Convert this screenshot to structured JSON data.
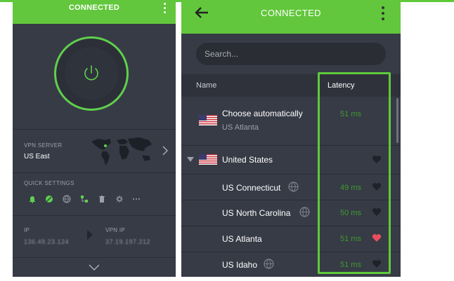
{
  "colors": {
    "accent": "#62c73c",
    "panel": "#373b46",
    "latency": "#3e9a2c",
    "favorite": "#e84e5d"
  },
  "left_panel": {
    "status": "CONNECTED",
    "vpn_server_label": "VPN SERVER",
    "vpn_server_value": "US East",
    "quick_settings_label": "QUICK SETTINGS",
    "quick_settings_icons": [
      "bell-icon",
      "block-icon",
      "globe-shield-icon",
      "network-icon",
      "trash-icon",
      "gear-icon",
      "more-icon"
    ],
    "ip_label": "IP",
    "ip_value": "136.49.23.124",
    "vpn_ip_label": "VPN IP",
    "vpn_ip_value": "37.19.197.212"
  },
  "right_panel": {
    "status": "CONNECTED",
    "search_placeholder": "Search...",
    "col_name": "Name",
    "col_latency": "Latency",
    "auto": {
      "name": "Choose automatically",
      "sub": "US Atlanta",
      "latency": "51 ms"
    },
    "country": {
      "name": "United States"
    },
    "servers": [
      {
        "name": "US Connecticut",
        "latency": "49 ms",
        "favorite": false
      },
      {
        "name": "US North Carolina",
        "latency": "50 ms",
        "favorite": false
      },
      {
        "name": "US Atlanta",
        "latency": "51 ms",
        "favorite": true
      },
      {
        "name": "US Idaho",
        "latency": "51 ms",
        "favorite": false
      }
    ]
  }
}
